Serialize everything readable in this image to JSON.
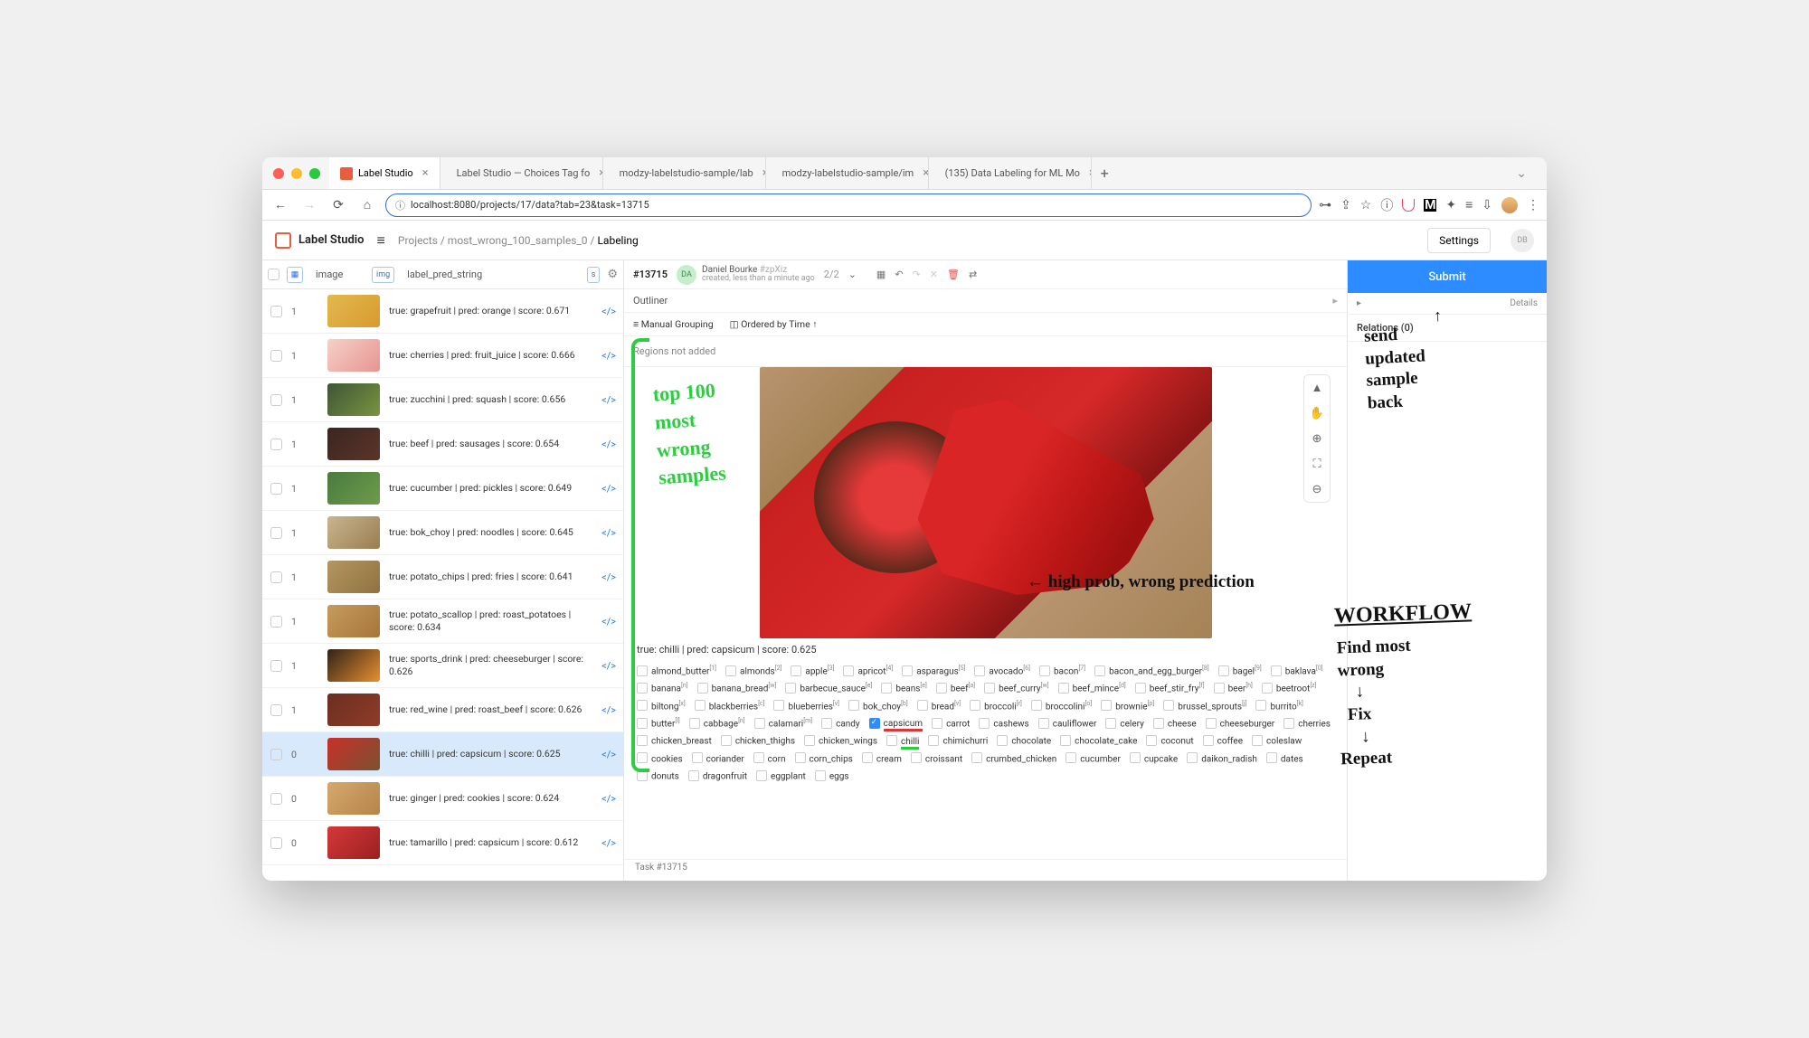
{
  "browser": {
    "tabs": [
      {
        "label": "Label Studio",
        "active": true,
        "icon": "ls"
      },
      {
        "label": "Label Studio — Choices Tag fo",
        "active": false,
        "icon": "ls"
      },
      {
        "label": "modzy-labelstudio-sample/lab",
        "active": false,
        "icon": "gh"
      },
      {
        "label": "modzy-labelstudio-sample/im",
        "active": false,
        "icon": "gh"
      },
      {
        "label": "(135) Data Labeling for ML Mo",
        "active": false,
        "icon": "yt"
      }
    ],
    "url": "localhost:8080/projects/17/data?tab=23&task=13715"
  },
  "app": {
    "brand": "Label Studio",
    "crumbs": [
      "Projects",
      "most_wrong_100_samples_0",
      "Labeling"
    ],
    "settings": "Settings",
    "user_initials": "DB"
  },
  "columns": {
    "image": "image",
    "img_badge": "img",
    "label": "label_pred_string",
    "s_badge": "s"
  },
  "rows": [
    {
      "id": "1",
      "desc": "true: grapefruit | pred: orange | score: 0.671",
      "thumb": "#e2b94f,#d89a2e"
    },
    {
      "id": "1",
      "desc": "true: cherries | pred: fruit_juice | score: 0.666",
      "thumb": "#f5d1c8,#e89490"
    },
    {
      "id": "1",
      "desc": "true: zucchini | pred: squash | score: 0.656",
      "thumb": "#3d5536,#7a9440"
    },
    {
      "id": "1",
      "desc": "true: beef | pred: sausages | score: 0.654",
      "thumb": "#3a2620,#5b3528"
    },
    {
      "id": "1",
      "desc": "true: cucumber | pred: pickles | score: 0.649",
      "thumb": "#4a7a3f,#6d9c4c"
    },
    {
      "id": "1",
      "desc": "true: bok_choy | pred: noodles | score: 0.645",
      "thumb": "#c9b590,#9a7d50"
    },
    {
      "id": "1",
      "desc": "true: potato_chips | pred: fries | score: 0.641",
      "thumb": "#b59662,#8f7240"
    },
    {
      "id": "1",
      "desc": "true: potato_scallop | pred: roast_potatoes | score: 0.634",
      "thumb": "#c79a5e,#a57638"
    },
    {
      "id": "1",
      "desc": "true: sports_drink | pred: cheeseburger | score: 0.626",
      "thumb": "#30221a,#e8902e"
    },
    {
      "id": "1",
      "desc": "true: red_wine | pred: roast_beef | score: 0.626",
      "thumb": "#6b2e20,#8f3c28"
    },
    {
      "id": "0",
      "desc": "true: chilli | pred: capsicum | score: 0.625",
      "thumb": "#c8302a,#7a5230",
      "selected": true
    },
    {
      "id": "0",
      "desc": "true: ginger | pred: cookies | score: 0.624",
      "thumb": "#d5a96e,#b5844a"
    },
    {
      "id": "0",
      "desc": "true: tamarillo | pred: capsicum | score: 0.612",
      "thumb": "#d43838,#9c2020"
    }
  ],
  "task": {
    "id": "#13715",
    "user": "Daniel Bourke",
    "handle": "#zpXiz",
    "meta": "created, less than a minute ago",
    "counter": "2/2",
    "caption": "true: chilli | pred: capsicum | score: 0.625",
    "footer": "Task #13715"
  },
  "outliner": {
    "title": "Outliner",
    "grouping": "Manual Grouping",
    "order": "Ordered by Time",
    "regions": "Regions not added"
  },
  "choices": [
    "almond_butter",
    "almonds",
    "apple",
    "apricot",
    "asparagus",
    "avocado",
    "bacon",
    "bacon_and_egg_burger",
    "bagel",
    "baklava",
    "banana",
    "banana_bread",
    "barbecue_sauce",
    "beans",
    "beef",
    "beef_curry",
    "beef_mince",
    "beef_stir_fry",
    "beer",
    "beetroot",
    "biltong",
    "blackberries",
    "blueberries",
    "bok_choy",
    "bread",
    "broccoli",
    "broccolini",
    "brownie",
    "brussel_sprouts",
    "burrito",
    "butter",
    "cabbage",
    "calamari",
    "candy",
    "capsicum",
    "carrot",
    "cashews",
    "cauliflower",
    "celery",
    "cheese",
    "cheeseburger",
    "cherries",
    "chicken_breast",
    "chicken_thighs",
    "chicken_wings",
    "chilli",
    "chimichurri",
    "chocolate",
    "chocolate_cake",
    "coconut",
    "coffee",
    "coleslaw",
    "cookies",
    "coriander",
    "corn",
    "corn_chips",
    "cream",
    "croissant",
    "crumbed_chicken",
    "cucumber",
    "cupcake",
    "daikon_radish",
    "dates",
    "donuts",
    "dragonfruit",
    "eggplant",
    "eggs"
  ],
  "choice_sup": [
    "[1]",
    "[2]",
    "[3]",
    "[4]",
    "[5]",
    "[6]",
    "[7]",
    "[8]",
    "[9]",
    "[0]",
    "[n]",
    "[w]",
    "[e]",
    "[e]",
    "[a]",
    "[w]",
    "[d]",
    "[f]",
    "[h]",
    "[z]",
    "[x]",
    "[c]",
    "[v]",
    "[b]",
    "[v]",
    "[r]",
    "[o]",
    "[p]",
    "[j]",
    "[k]",
    "[l]",
    "[n]",
    "[m]"
  ],
  "checked_choice": "capsicum",
  "right": {
    "submit": "Submit",
    "details": "Details",
    "relations": "Relations (0)"
  },
  "annotations": {
    "left": "top 100\nmost\nwrong\nsamples",
    "caption_note": "← high prob, wrong prediction",
    "send": "send\nupdated\nsample\nback",
    "workflow_title": "WORKFLOW",
    "workflow": "Find most\nwrong\n↓\nFix\n↓\nRepeat"
  }
}
